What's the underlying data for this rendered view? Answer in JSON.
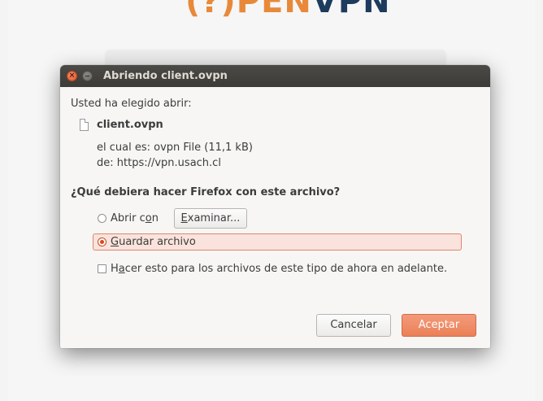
{
  "background": {
    "logo_part1": "(?)PEN",
    "logo_part2": "VPN"
  },
  "dialog": {
    "title": "Abriendo client.ovpn",
    "intro": "Usted ha elegido abrir:",
    "file_name": "client.ovpn",
    "file_type_line": "el cual es: ovpn File (11,1 kB)",
    "source_line": "de: https://vpn.usach.cl",
    "question": "¿Qué debiera hacer Firefox con este archivo?",
    "open_with": {
      "label_pre": "Abrir c",
      "label_mnemonic": "o",
      "label_post": "n",
      "checked": false
    },
    "browse_button": {
      "label_mnemonic": "E",
      "label_post": "xaminar..."
    },
    "save_file": {
      "label_mnemonic": "G",
      "label_post": "uardar archivo",
      "checked": true
    },
    "remember": {
      "label_pre": "H",
      "label_mnemonic": "a",
      "label_post": "cer esto para los archivos de este tipo de ahora en adelante.",
      "checked": false
    },
    "cancel_label": "Cancelar",
    "accept_label": "Aceptar"
  },
  "colors": {
    "accent": "#dd4814",
    "titlebar": "#3c3b37",
    "dialog_bg": "#f7f6f5"
  }
}
